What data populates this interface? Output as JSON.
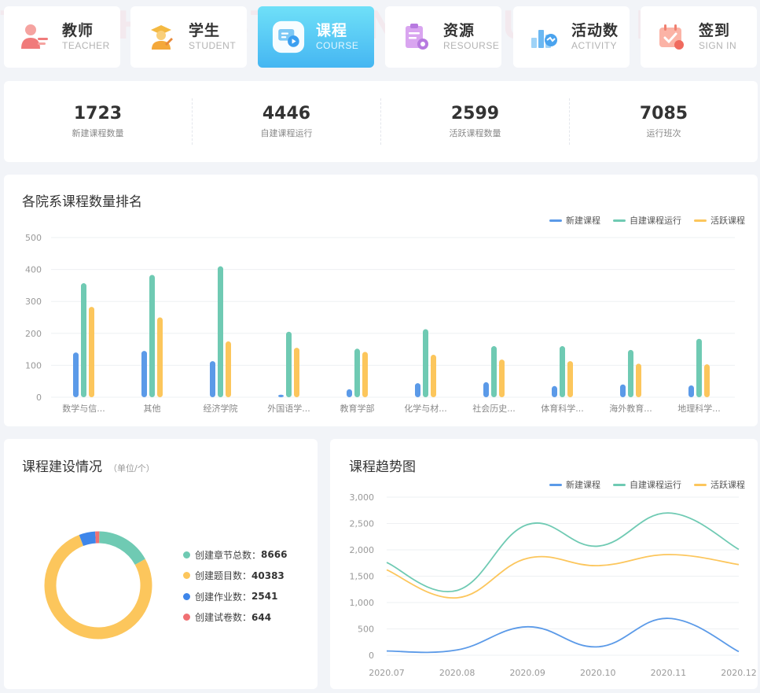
{
  "watermark": "TEACHER STUDENT COURSE RESOURSE ACTIVITY SIGN IN",
  "nav": [
    {
      "cn": "教师",
      "en": "TEACHER",
      "icon": "teacher-icon",
      "active": false
    },
    {
      "cn": "学生",
      "en": "STUDENT",
      "icon": "student-icon",
      "active": false
    },
    {
      "cn": "课程",
      "en": "COURSE",
      "icon": "course-icon",
      "active": true
    },
    {
      "cn": "资源",
      "en": "RESOURSE",
      "icon": "resource-icon",
      "active": false
    },
    {
      "cn": "活动数",
      "en": "ACTIVITY",
      "icon": "activity-icon",
      "active": false
    },
    {
      "cn": "签到",
      "en": "SIGN IN",
      "icon": "sign-in-icon",
      "active": false
    }
  ],
  "stats": [
    {
      "value": "1723",
      "label": "新建课程数量"
    },
    {
      "value": "4446",
      "label": "自建课程运行"
    },
    {
      "value": "2599",
      "label": "活跃课程数量"
    },
    {
      "value": "7085",
      "label": "运行班次"
    }
  ],
  "colors": {
    "blue": "#5b9ae8",
    "green": "#6fcab3",
    "yellow": "#fcc65c",
    "red": "#f07073",
    "donut_blue": "#3e86ea",
    "active_nav": "#45b6f2"
  },
  "dept_chart": {
    "title": "各院系课程数量排名"
  },
  "course_build": {
    "title": "课程建设情况",
    "unit": "（单位/个）",
    "items": [
      {
        "label": "创建章节总数：",
        "value": "8666",
        "color": "#6fcab3"
      },
      {
        "label": "创建题目数：",
        "value": "40383",
        "color": "#fcc65c"
      },
      {
        "label": "创建作业数：",
        "value": "2541",
        "color": "#3e86ea"
      },
      {
        "label": "创建试卷数：",
        "value": "644",
        "color": "#f07073"
      }
    ]
  },
  "trend_chart": {
    "title": "课程趋势图"
  },
  "chart_data": [
    {
      "type": "bar",
      "title": "各院系课程数量排名",
      "categories": [
        "数学与信...",
        "其他",
        "经济学院",
        "外国语学...",
        "教育学部",
        "化学与材...",
        "社会历史...",
        "体育科学...",
        "海外教育...",
        "地理科学..."
      ],
      "series": [
        {
          "name": "新建课程",
          "color": "#5b9ae8",
          "values": [
            140,
            145,
            113,
            8,
            25,
            44,
            47,
            35,
            40,
            37
          ]
        },
        {
          "name": "自建课程运行",
          "color": "#6fcab3",
          "values": [
            357,
            383,
            410,
            205,
            152,
            213,
            160,
            160,
            148,
            183
          ]
        },
        {
          "name": "活跃课程",
          "color": "#fcc65c",
          "values": [
            283,
            250,
            175,
            155,
            142,
            133,
            118,
            113,
            105,
            103
          ]
        }
      ],
      "yticks": [
        "0",
        "100",
        "200",
        "300",
        "400",
        "500"
      ],
      "ylim": [
        0,
        500
      ],
      "legend": "top-right",
      "grid": true
    },
    {
      "type": "pie",
      "title": "课程建设情况",
      "labels": [
        "创建章节总数",
        "创建题目数",
        "创建作业数",
        "创建试卷数"
      ],
      "values": [
        8666,
        40383,
        2541,
        644
      ],
      "colors": [
        "#6fcab3",
        "#fcc65c",
        "#3e86ea",
        "#f07073"
      ]
    },
    {
      "type": "line",
      "title": "课程趋势图",
      "x": [
        "2020.07",
        "2020.08",
        "2020.09",
        "2020.10",
        "2020.11",
        "2020.12"
      ],
      "series": [
        {
          "name": "新建课程",
          "color": "#5b9ae8",
          "values": [
            80,
            100,
            540,
            160,
            700,
            70
          ]
        },
        {
          "name": "自建课程运行",
          "color": "#6fcab3",
          "values": [
            1760,
            1230,
            2480,
            2070,
            2700,
            2010
          ]
        },
        {
          "name": "活跃课程",
          "color": "#fcc65c",
          "values": [
            1620,
            1090,
            1840,
            1700,
            1910,
            1720
          ]
        }
      ],
      "yticks": [
        "0",
        "500",
        "1,000",
        "1,500",
        "2,000",
        "2,500",
        "3,000"
      ],
      "ylim": [
        0,
        3000
      ],
      "legend": "top-right",
      "grid": true
    }
  ]
}
